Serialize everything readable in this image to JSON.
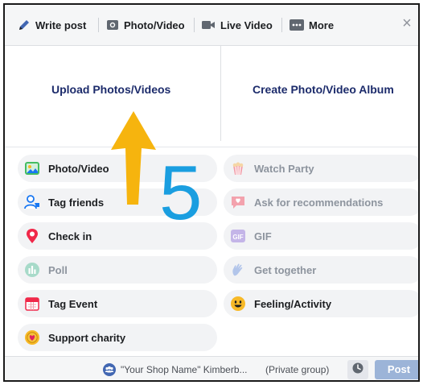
{
  "tabs": [
    {
      "label": "Write post",
      "icon": "pencil-icon"
    },
    {
      "label": "Photo/Video",
      "icon": "camera-icon"
    },
    {
      "label": "Live Video",
      "icon": "video-camera-icon"
    },
    {
      "label": "More",
      "icon": "more-icon"
    }
  ],
  "close_label": "×",
  "upload": {
    "upload_label": "Upload Photos/Videos",
    "album_label": "Create Photo/Video Album"
  },
  "options": [
    {
      "label": "Photo/Video",
      "icon": "photo-icon",
      "enabled": true
    },
    {
      "label": "Watch Party",
      "icon": "popcorn-icon",
      "enabled": false
    },
    {
      "label": "Tag friends",
      "icon": "tag-friends-icon",
      "enabled": true
    },
    {
      "label": "Ask for recommendations",
      "icon": "recommendation-icon",
      "enabled": false
    },
    {
      "label": "Check in",
      "icon": "location-pin-icon",
      "enabled": true
    },
    {
      "label": "GIF",
      "icon": "gif-icon",
      "enabled": false
    },
    {
      "label": "Poll",
      "icon": "poll-icon",
      "enabled": false
    },
    {
      "label": "Get together",
      "icon": "wave-hand-icon",
      "enabled": false
    },
    {
      "label": "Tag Event",
      "icon": "calendar-icon",
      "enabled": true
    },
    {
      "label": "Feeling/Activity",
      "icon": "smiley-icon",
      "enabled": true
    },
    {
      "label": "Support charity",
      "icon": "charity-heart-icon",
      "enabled": true
    }
  ],
  "footer": {
    "group_name": "\"Your Shop Name\" Kimberb...",
    "privacy": "(Private group)",
    "post_label": "Post"
  },
  "annotation": {
    "step_number": "5",
    "arrow_color": "#f6b40e",
    "number_color": "#1a9ee0"
  },
  "colors": {
    "accent_blue": "#1c2b6b",
    "post_button": "#9cb4d8",
    "option_bg": "#f2f3f5"
  }
}
